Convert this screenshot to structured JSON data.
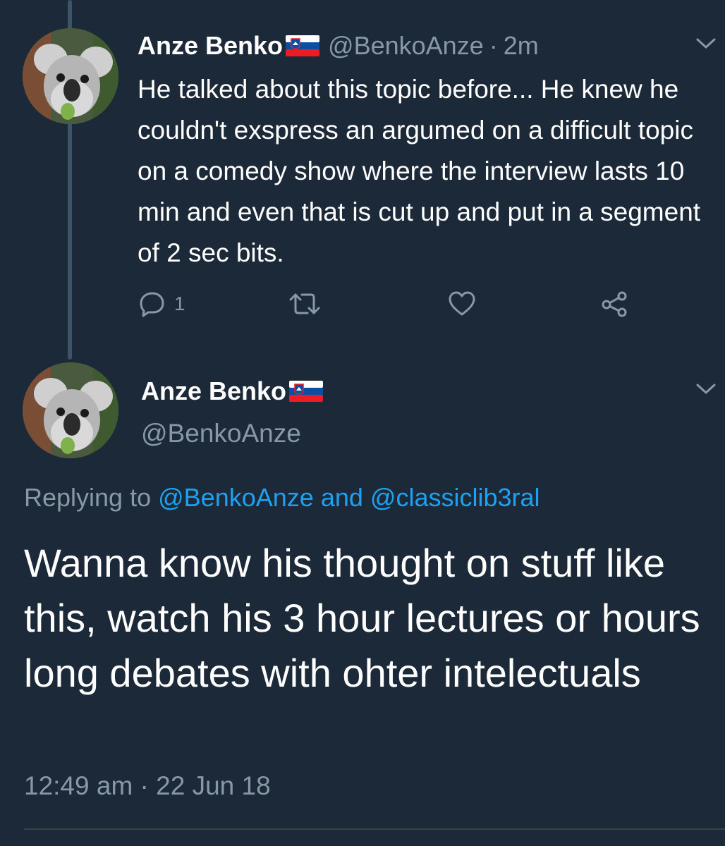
{
  "tweet1": {
    "author_name": "Anze Benko",
    "flag": "slovenia-flag",
    "handle": "@BenkoAnze",
    "separator": "·",
    "time": "2m",
    "text": "He talked about this topic before... He knew he couldn't exspress an argumed on a difficult topic on a comedy show where the interview lasts 10 min and even that is cut up and put in a segment of 2 sec bits.",
    "reply_count": "1",
    "icons": [
      "reply-icon",
      "retweet-icon",
      "like-icon",
      "share-icon",
      "chevron-down-icon"
    ]
  },
  "tweet2": {
    "author_name": "Anze Benko",
    "flag": "slovenia-flag",
    "handle": "@BenkoAnze",
    "replying_prefix": "Replying to",
    "replying_mention_1": "@BenkoAnze",
    "replying_and": "and",
    "replying_mention_2": "@classiclib3ral",
    "text": "Wanna know his thought on stuff like this, watch his 3 hour lectures or hours long debates with ohter intelectuals",
    "timestamp": "12:49 am · 22 Jun 18"
  },
  "colors": {
    "background": "#1c2938",
    "muted": "#8899a6",
    "link": "#1da1f2",
    "thread_line": "#3d5466"
  }
}
